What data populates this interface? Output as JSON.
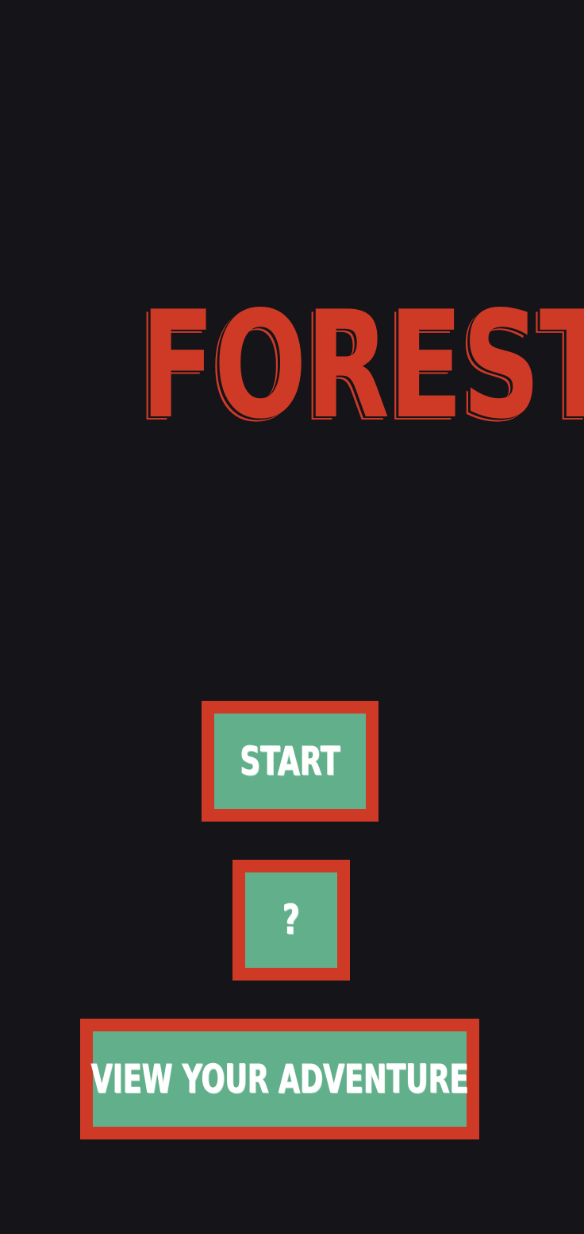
{
  "game": {
    "title": "FOREST"
  },
  "menu": {
    "start_label": "START",
    "help_label": "?",
    "adventure_label": "VIEW YOUR ADVENTURE"
  },
  "colors": {
    "background": "#151418",
    "accent_red": "#cf3a27",
    "button_green": "#62b08b",
    "button_text": "#ffffff"
  }
}
